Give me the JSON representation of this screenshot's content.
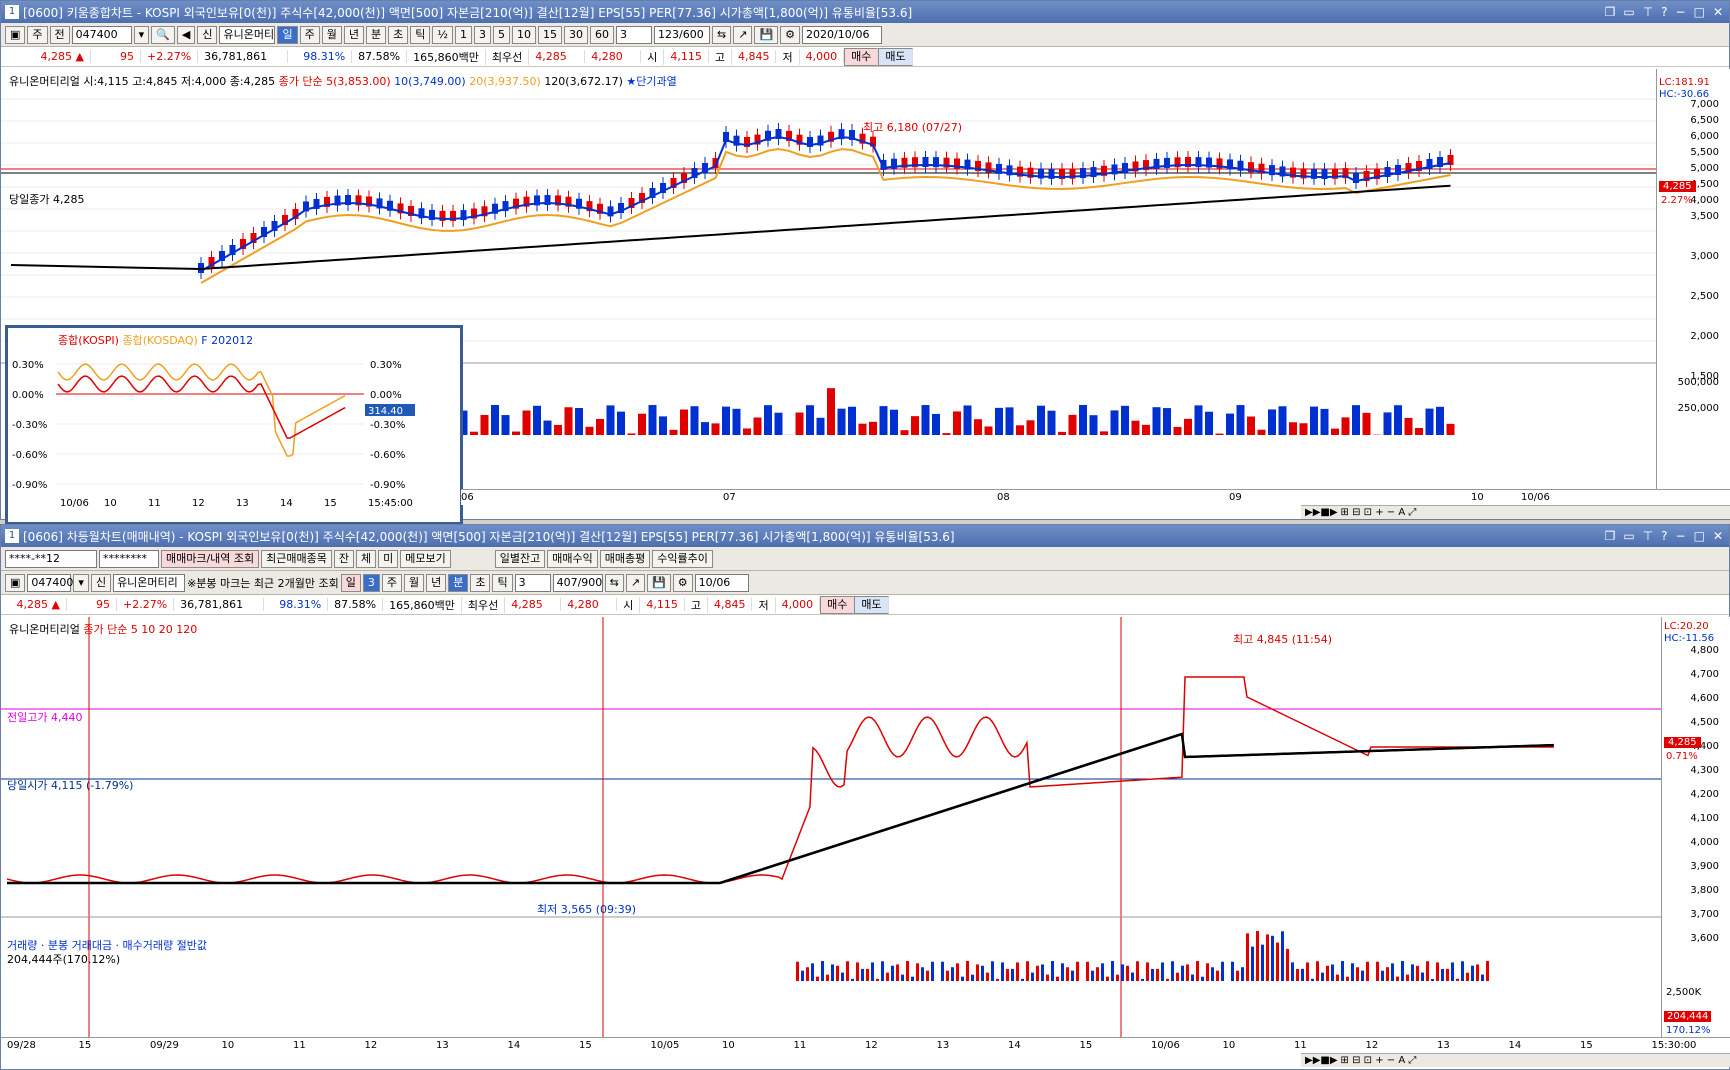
{
  "top": {
    "title": "[0600] 키움종합차트 - KOSPI 외국인보유[0(천)] 주식수[42,000(천)] 액면[500] 자본금[210(억)] 결산[12월] EPS[55] PER[77.36] 시가총액[1,800(억)] 유통비율[53.6]",
    "toolbar": {
      "mode": "주",
      "prev": "전",
      "code": "047400",
      "name": "유니온머티",
      "period_tabs": [
        "일",
        "주",
        "월",
        "년",
        "분",
        "초",
        "틱"
      ],
      "nums": [
        "1",
        "3",
        "5",
        "10",
        "15",
        "30",
        "60"
      ],
      "sel_num": "3",
      "count": "123/600",
      "date": "2020/10/06"
    },
    "quote": {
      "price": "4,285 ▲",
      "change": "95",
      "pct": "+2.27%",
      "volume": "36,781,861",
      "ratio1": "98.31%",
      "ratio2": "87.58%",
      "amount": "165,860백만",
      "best_label": "최우선",
      "best1": "4,285",
      "best2": "4,280",
      "open_label": "시",
      "open": "4,115",
      "high_label": "고",
      "high": "4,845",
      "low_label": "저",
      "low": "4,000",
      "buy": "매수",
      "sell": "매도"
    },
    "legend": {
      "stock": "유니온머티리얼 시:4,115 고:4,845 저:4,000 종:4,285",
      "ma_label": "종가 단순",
      "ma5": "5(3,853.00)",
      "ma10": "10(3,749.00)",
      "ma20": "20(3,937.50)",
      "ma120": "120(3,672.17)",
      "star": "★단기과열"
    },
    "annot": {
      "high": "최고 6,180 (07/27)",
      "close_line": "당일종가 4,285",
      "price_tag": "4,285",
      "pct_tag": "2.27%"
    },
    "lc": "LC:181.91",
    "hc": "HC:-30.66",
    "price_ticks": [
      "7,000",
      "6,500",
      "6,000",
      "5,500",
      "5,000",
      "4,500",
      "4,000",
      "3,500",
      "3,000",
      "2,500",
      "2,000",
      "1,500"
    ],
    "vol_ticks": [
      "500,000",
      "250,000"
    ],
    "x_ticks": [
      "06",
      "07",
      "08",
      "09",
      "10",
      "10/06"
    ],
    "inset": {
      "legend": [
        "종합(KOSPI)",
        "종합(KOSDAQ)",
        "F 202012"
      ],
      "ticks": [
        "0.30%",
        "0.00%",
        "-0.30%",
        "-0.60%",
        "-0.90%"
      ],
      "tag": "314.40",
      "x": [
        "10/06",
        "10",
        "11",
        "12",
        "13",
        "14",
        "15",
        "15:45:00"
      ]
    }
  },
  "bottom": {
    "title": "[0606] 차등월차트(매매내역) - KOSPI 외국인보유[0(천)] 주식수[42,000(천)] 액면[500] 자본금[210(억)] 결산[12월] EPS[55] PER[77.36] 시가총액[1,800(억)] 유통비율[53.6]",
    "toolbar1": {
      "acct": "****-**12",
      "pw": "********",
      "b1": "매매마크/내역 조회",
      "b2": "최근매매종목",
      "b3": "잔",
      "b4": "체",
      "b5": "미",
      "b6": "메모보기",
      "b7": "일별잔고",
      "b8": "매매수익",
      "b9": "매매총평",
      "b10": "수익률추이"
    },
    "toolbar2": {
      "code": "047400",
      "name": "유니온머티리",
      "note": "※분봉 마크는 최근 2개월만 조회",
      "tabs": [
        "일",
        "3",
        "주",
        "월",
        "년",
        "분",
        "초",
        "틱"
      ],
      "num": "3",
      "count": "407/900",
      "date": "10/06"
    },
    "legend": {
      "stock": "유니온머티리얼",
      "ma": "종가 단순 5 10 20 120"
    },
    "annot": {
      "high": "최고 4,845 (11:54)",
      "low": "최저 3,565 (09:39)",
      "prev_high": "전일고가 4,440",
      "open": "당일시가 4,115 (-1.79%)",
      "tag": "4,285",
      "pct": "0.71%"
    },
    "lc": "LC:20.20",
    "hc": "HC:-11.56",
    "price_ticks": [
      "4,800",
      "4,700",
      "4,600",
      "4,500",
      "4,400",
      "4,300",
      "4,200",
      "4,100",
      "4,000",
      "3,900",
      "3,800",
      "3,700",
      "3,600"
    ],
    "vol_legend": "거래량 · 분봉 거래대금 · 매수거래량 절반값",
    "vol_info": "204,444주(170.12%)",
    "vol_ticks": [
      "2,500K"
    ],
    "vol_tag": "204,444",
    "vol_pct": "170.12%",
    "x_ticks": [
      "09/28",
      "15",
      "09/29",
      "10",
      "11",
      "12",
      "13",
      "14",
      "15",
      "10/05",
      "10",
      "11",
      "12",
      "13",
      "14",
      "15",
      "10/06",
      "10",
      "11",
      "12",
      "13",
      "14",
      "15",
      "15:30:00"
    ]
  }
}
